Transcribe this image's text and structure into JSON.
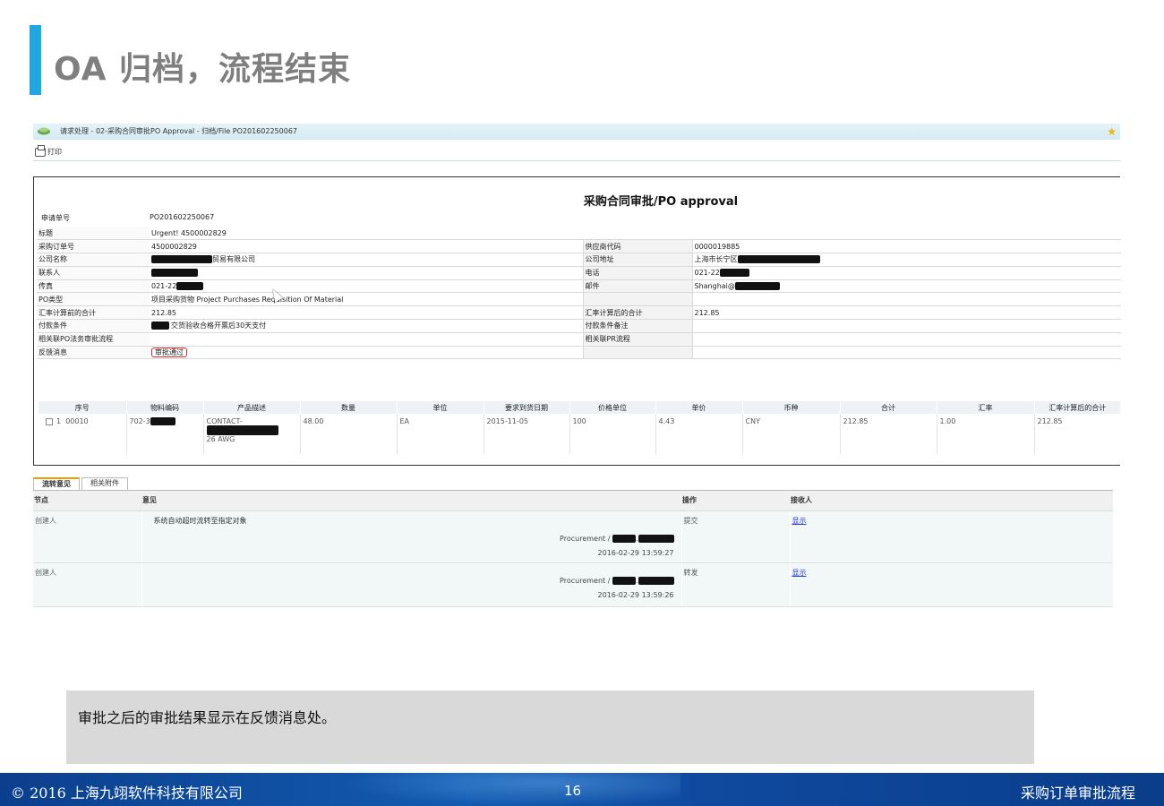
{
  "slide": {
    "title": "OA 归档，流程结束",
    "note": "审批之后的审批结果显示在反馈消息处。"
  },
  "window": {
    "title": "请求处理 - 02-采购合同审批PO Approval - 归档/File PO201602250067",
    "print_label": "打印"
  },
  "form": {
    "title": "采购合同审批/PO approval",
    "request_no_label": "申请单号",
    "request_no": "PO201602250067",
    "rows": [
      {
        "k": "标题",
        "v": "Urgent! 4500002829",
        "k2": "",
        "v2": ""
      },
      {
        "k": "采购订单号",
        "v": "4500002829",
        "k2": "供应商代码",
        "v2": "0000019885"
      },
      {
        "k": "公司名称",
        "v": "贸易有限公司",
        "k2": "公司地址",
        "v2": "上海市长宁区"
      },
      {
        "k": "联系人",
        "v": "",
        "k2": "电话",
        "v2": "021-22"
      },
      {
        "k": "传真",
        "v": "021-22",
        "k2": "邮件",
        "v2": "Shanghai@"
      },
      {
        "k": "PO类型",
        "v": "项目采购货物 Project Purchases Requisition Of Material",
        "k2": "",
        "v2": ""
      },
      {
        "k": "汇率计算前的合计",
        "v": "212.85",
        "k2": "汇率计算后的合计",
        "v2": "212.85"
      },
      {
        "k": "付款条件",
        "v": "交货验收合格开票后30天支付",
        "k2": "付款条件备注",
        "v2": ""
      },
      {
        "k": "相关联PO法务审批流程",
        "v": "",
        "k2": "相关联PR流程",
        "v2": ""
      },
      {
        "k": "反馈消息",
        "v": "审批通过",
        "k2": "",
        "v2": ""
      }
    ],
    "items_headers": [
      "序号",
      "物料编码",
      "产品描述",
      "数量",
      "单位",
      "要求到货日期",
      "价格单位",
      "单价",
      "币种",
      "合计",
      "汇率",
      "汇率计算后的合计"
    ],
    "items": [
      {
        "seq": "1",
        "line": "00010",
        "material": "702-3",
        "desc1": "CONTACT-",
        "desc2": "26 AWG",
        "qty": "48.00",
        "unit": "EA",
        "date": "2015-11-05",
        "price_unit": "100",
        "price": "4.43",
        "currency": "CNY",
        "total": "212.85",
        "rate": "1.00",
        "total_after": "212.85"
      }
    ]
  },
  "tabs": [
    "流转意见",
    "相关附件"
  ],
  "flow": {
    "headers": {
      "node": "节点",
      "opinion": "意见",
      "op": "操作",
      "receiver": "接收人"
    },
    "rows": [
      {
        "node": "创建人",
        "opinion": "系统自动超时流转至指定对象",
        "signer": "Procurement /",
        "time": "2016-02-29 13:59:27",
        "op": "提交",
        "receiver": "显示"
      },
      {
        "node": "创建人",
        "opinion": "",
        "signer": "Procurement /",
        "time": "2016-02-29 13:59:26",
        "op": "转发",
        "receiver": "显示"
      }
    ]
  },
  "footer": {
    "copyright": "© 2016 上海九翊软件科技有限公司",
    "page": "16",
    "section": "采购订单审批流程"
  },
  "colors": {
    "accent": "#1ea7e1",
    "footer": "#0f4a9f",
    "highlight": "#e0262e"
  }
}
